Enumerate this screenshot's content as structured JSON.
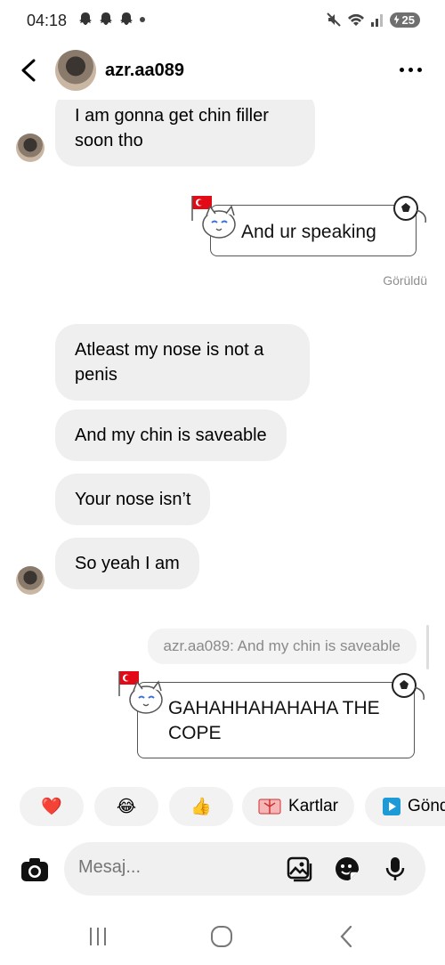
{
  "status": {
    "time": "04:18",
    "battery": "25"
  },
  "header": {
    "username": "azr.aa089"
  },
  "messages": {
    "m1": "I am gonna get chin filler soon tho",
    "m2": "And ur speaking",
    "seen": "Görüldü",
    "m3": "Atleast my nose is not a penis",
    "m4": "And my chin is saveable",
    "m5": "Your nose isn’t",
    "m6": "So yeah I am",
    "reply_preview": "azr.aa089: And my chin is saveable",
    "m7_line1": "GAHAHHAHAHAHA THE",
    "m7_line2": "COPE"
  },
  "quick_replies": {
    "heart": "❤️",
    "laugh": "😂",
    "thumbs": "👍",
    "cards_label": "Kartlar",
    "send_label": "Gönd"
  },
  "composer": {
    "placeholder": "Mesaj..."
  },
  "colors": {
    "bubble_in": "#efefef",
    "text_muted": "#8e8e8e",
    "flag_red": "#e30a17"
  }
}
